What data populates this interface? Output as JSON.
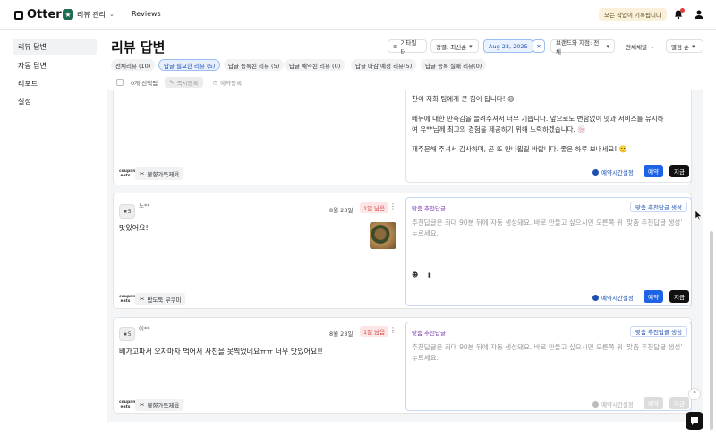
{
  "app": {
    "name": "Otter",
    "store_label": "리뷰 관리",
    "nav_reviews": "Reviews",
    "record_badge": "모든 작업이 기록됩니다"
  },
  "sidebar": {
    "items": [
      {
        "label": "리뷰 답변",
        "active": true
      },
      {
        "label": "자동 답변",
        "active": false
      },
      {
        "label": "리포트",
        "active": false
      },
      {
        "label": "설정",
        "active": false
      }
    ]
  },
  "header": {
    "title": "리뷰 답변",
    "filter_label": "기타필터",
    "sort_label": "정렬: 최신순",
    "date_value": "Aug 23, 2025",
    "brand_label": "브랜드와 지점: 전체",
    "channel_label": "전체채널",
    "rating_label": "별점 순"
  },
  "tabs": [
    {
      "label": "전체리뷰 (10)",
      "active": false
    },
    {
      "label": "답글 필요한 리뷰 (5)",
      "active": true
    },
    {
      "label": "답글 등록된 리뷰 (5)",
      "active": false
    },
    {
      "label": "답글 예약된 리뷰 (0)",
      "active": false
    },
    {
      "label": "답글 마감 예정 리뷰(5)",
      "active": false
    },
    {
      "label": "답글 등록 실패 리뷰(0)",
      "active": false
    }
  ],
  "selection": {
    "count_label": "0개 선택됨",
    "bulk_register": "즉시등록",
    "bulk_reserve": "예약등록"
  },
  "cards": [
    {
      "reply_lines": [
        "찬이 저희 팀에게 큰 힘이 됩니다! 😊",
        "",
        "메뉴에 대한 만족감을 들려주셔서 너무 기쁩니다. 앞으로도 변함없이 맛과 서비스를 유지하",
        "여 유**님께 최고의 경험을 제공하기 위해 노력하겠습니다. 🍥",
        "",
        "재주문해 주셔서 감사하며, 곧 또 만나뵙길 바랍니다. 좋은 하루 보내세요! 🙂"
      ],
      "platform": "coupang eats",
      "tag": "불향가득제육",
      "schedule": "예약시간설정",
      "reserve_btn": "예약",
      "now_btn": "지금"
    },
    {
      "rating": "★5",
      "reviewer": "노**",
      "date": "8월 23일",
      "overdue": "1일 남음",
      "text": "맛있어요!",
      "suggest_label": "맞춤 추천답글",
      "suggest_btn": "맞춤 추천답글 생성",
      "reply_placeholder": "추천답글은 최대 90분 뒤에 자동 생성돼요. 바로 만들고 싶으시면 오른쪽 위 '맞춤 추천답글 생성' 누르세요.",
      "platform": "coupang eats",
      "tag": "밥도둑 부쿠미",
      "schedule": "예약시간설정",
      "reserve_btn": "예약",
      "now_btn": "지금"
    },
    {
      "rating": "★5",
      "reviewer": "이**",
      "date": "8월 23일",
      "overdue": "1일 남음",
      "text": "배가고파서 오자마자 먹어서 사진을 못찍었네요ㅠㅠ 너무 맛있어요!!",
      "suggest_label": "맞춤 추천답글",
      "suggest_btn": "맞춤 추천답글 생성",
      "reply_placeholder": "추천답글은 최대 90분 뒤에 자동 생성돼요. 바로 만들고 싶으시면 오른쪽 위 '맞춤 추천답글 생성' 누르세요.",
      "platform": "coupang eats",
      "tag": "불향가득제육",
      "schedule": "예약시간설정",
      "reserve_btn": "예약",
      "now_btn": "지금"
    }
  ],
  "colors": {
    "accent_blue": "#1e63e6",
    "overdue_red": "#d14343",
    "suggest_purple": "#7a3bb5",
    "brand_green": "#1f6b4f"
  }
}
